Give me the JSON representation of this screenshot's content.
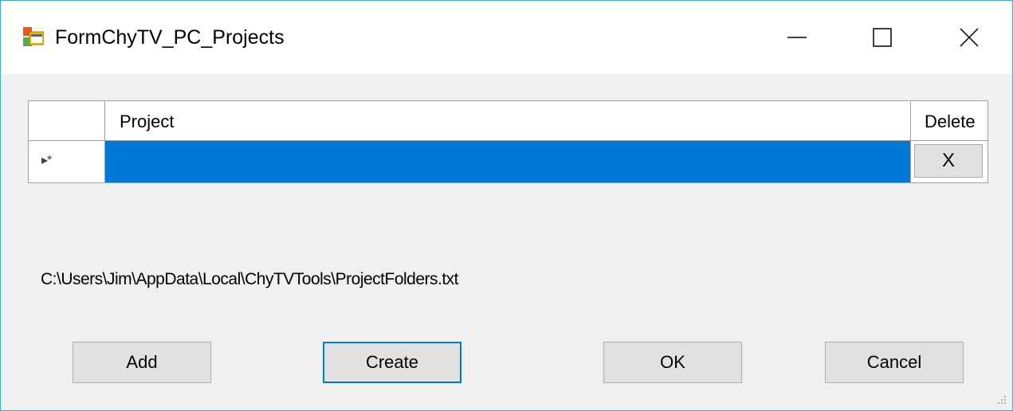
{
  "window": {
    "title": "FormChyTV_PC_Projects",
    "icon": "windows-form-icon",
    "controls": {
      "minimize_icon": "minimize-icon",
      "maximize_icon": "maximize-icon",
      "close_icon": "close-icon"
    }
  },
  "grid": {
    "columns": [
      "Project",
      "Delete"
    ],
    "rows": [
      {
        "indicator": "▸*",
        "project": "",
        "delete_label": "X",
        "selected": true
      }
    ]
  },
  "path_text": "C:\\Users\\Jim\\AppData\\Local\\ChyTVTools\\ProjectFolders.txt",
  "buttons": {
    "add": "Add",
    "create": "Create",
    "ok": "OK",
    "cancel": "Cancel"
  },
  "colors": {
    "selection": "#0078d7",
    "focus_border": "#0078d7",
    "window_border": "#3fa9d6"
  }
}
